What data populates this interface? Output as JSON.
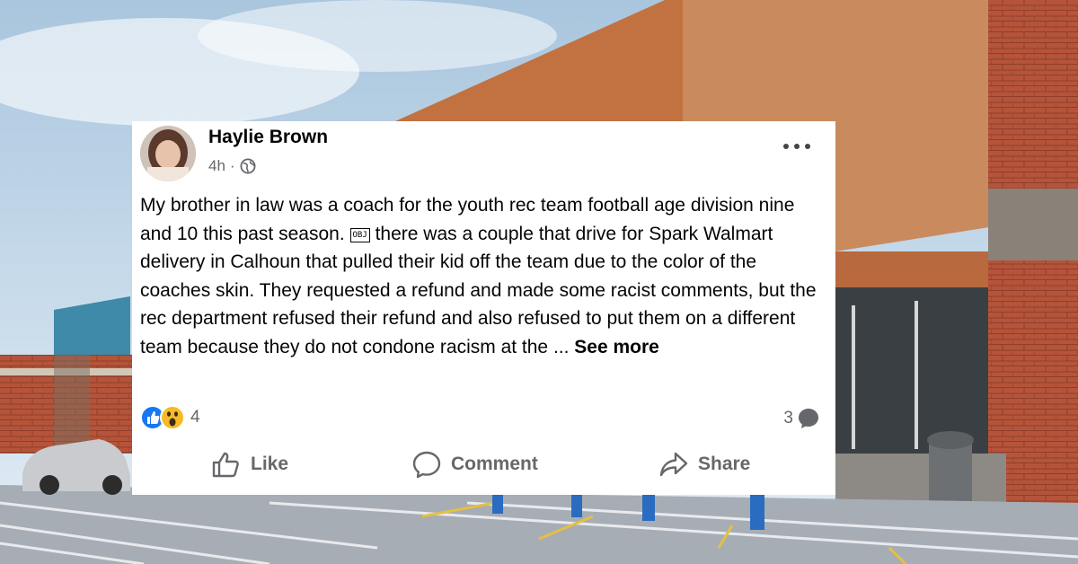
{
  "post": {
    "author": "Haylie Brown",
    "time": "4h",
    "separator": "·",
    "privacy_icon": "globe-icon",
    "text_part1": "My brother in law was a coach for the youth rec team football age division nine and 10 this past season. ",
    "obj_placeholder": "OBJ",
    "text_part2": " there was a couple that drive for Spark Walmart delivery in Calhoun that pulled their kid off the team due to the color of the coaches skin. They requested a refund and made some racist comments, but the rec department refused their refund and also refused to put them on a different team because they do not condone racism at the ... ",
    "see_more": "See more",
    "reaction_icons": [
      "like-reaction-icon",
      "wow-reaction-icon"
    ],
    "reaction_count": "4",
    "comment_count": "3",
    "colors": {
      "like_blue": "#1877f2",
      "wow_yellow": "#f7b928",
      "muted": "#65676b"
    }
  },
  "actions": {
    "like_label": "Like",
    "comment_label": "Comment",
    "share_label": "Share"
  }
}
